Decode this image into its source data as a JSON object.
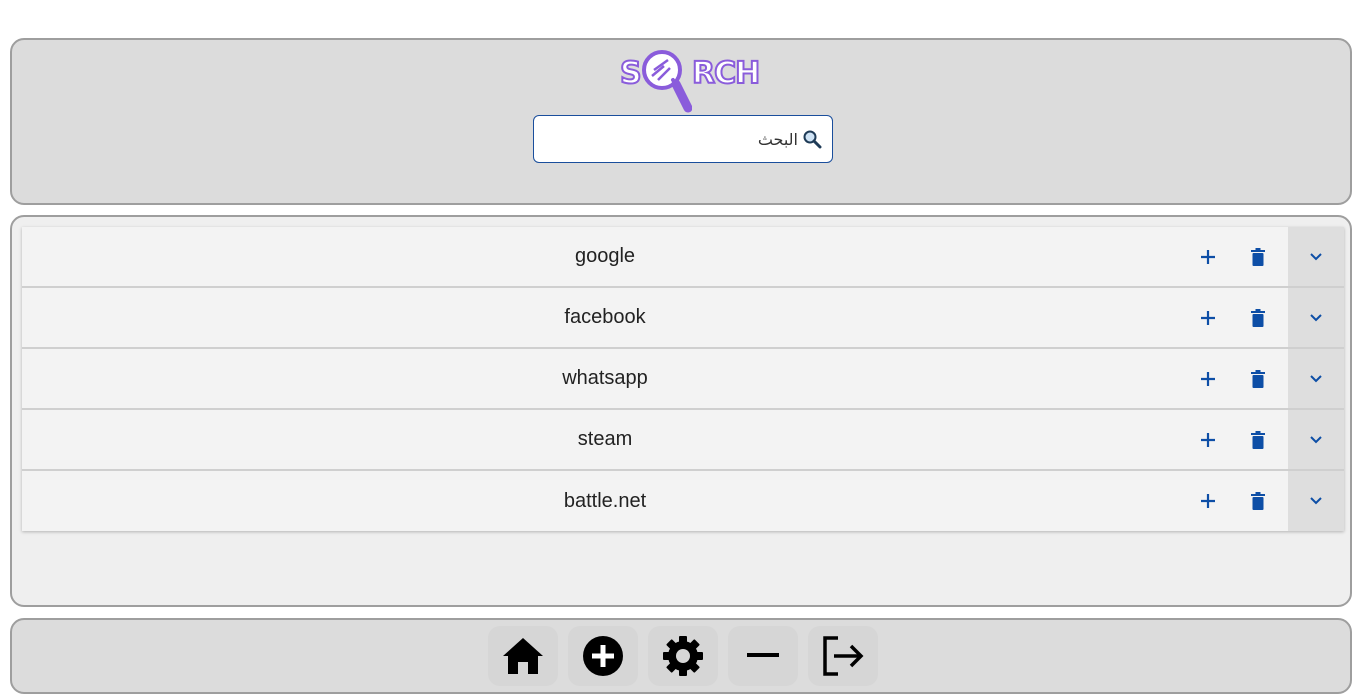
{
  "header": {
    "logo_text_left": "S",
    "logo_text_right": "RCH",
    "logo_color": "#8a5cdb",
    "search": {
      "placeholder": "البحث",
      "value": "",
      "icon": "magnifier-icon"
    }
  },
  "sites": [
    {
      "name": "google"
    },
    {
      "name": "facebook"
    },
    {
      "name": "whatsapp"
    },
    {
      "name": "steam"
    },
    {
      "name": "battle.net"
    }
  ],
  "row_actions": {
    "add_icon": "plus-icon",
    "delete_icon": "trash-icon",
    "expand_icon": "chevron-down-icon",
    "accent_color": "#0d4ea6"
  },
  "footer": {
    "nav_items": [
      {
        "icon": "home-icon"
      },
      {
        "icon": "add-circle-icon"
      },
      {
        "icon": "gear-icon"
      },
      {
        "icon": "minus-icon"
      },
      {
        "icon": "logout-icon"
      }
    ]
  }
}
